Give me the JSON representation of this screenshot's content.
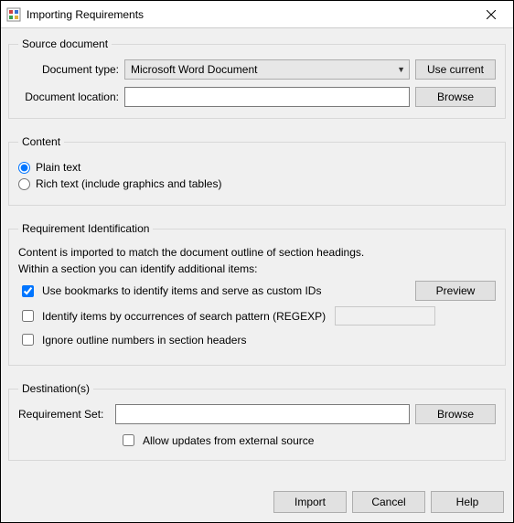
{
  "window": {
    "title": "Importing Requirements"
  },
  "source": {
    "legend": "Source document",
    "doc_type_label": "Document type:",
    "doc_type_value": "Microsoft Word Document",
    "use_current": "Use current",
    "doc_location_label": "Document location:",
    "doc_location_value": "",
    "browse": "Browse"
  },
  "content": {
    "legend": "Content",
    "plain": "Plain text",
    "rich": "Rich text (include graphics and tables)",
    "selected": "plain"
  },
  "reqid": {
    "legend": "Requirement Identification",
    "desc1": "Content is imported to match the document outline of section headings.",
    "desc2": "Within a section you can identify additional items:",
    "use_bookmarks": "Use bookmarks to identify items and serve as custom IDs",
    "preview": "Preview",
    "identify_regexp": "Identify items by occurrences of search pattern (REGEXP)",
    "regexp_value": "",
    "ignore_outline": "Ignore outline numbers in section headers",
    "checked": {
      "bookmarks": true,
      "regexp": false,
      "ignore": false
    }
  },
  "dest": {
    "legend": "Destination(s)",
    "reqset_label": "Requirement Set:",
    "reqset_value": "",
    "browse": "Browse",
    "allow_updates": "Allow updates from external source",
    "allow_updates_checked": false
  },
  "buttons": {
    "import": "Import",
    "cancel": "Cancel",
    "help": "Help"
  }
}
